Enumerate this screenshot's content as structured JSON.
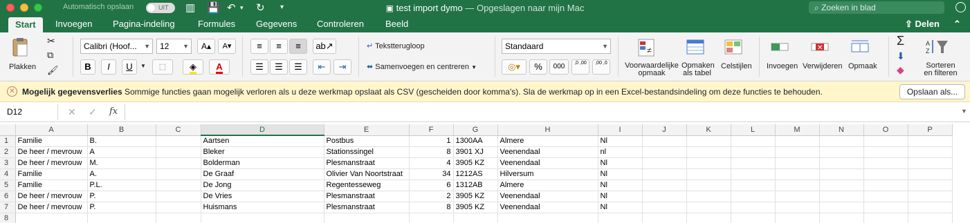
{
  "titlebar": {
    "autosave_label": "Automatisch opslaan",
    "autosave_state": "UIT",
    "doc_name": "test import dymo",
    "doc_status": "— Opgeslagen naar mijn Mac",
    "search_placeholder": "Zoeken in blad"
  },
  "tabs": [
    "Start",
    "Invoegen",
    "Pagina-indeling",
    "Formules",
    "Gegevens",
    "Controleren",
    "Beeld"
  ],
  "share_label": "Delen",
  "ribbon": {
    "paste_label": "Plakken",
    "font_name": "Calibri (Hoof...",
    "font_size": "12",
    "wrap_label": "Tekstterugloop",
    "merge_label": "Samenvoegen en centreren",
    "number_format": "Standaard",
    "conditional_label": "Voorwaardelijke opmaak",
    "format_table_label": "Opmaken als tabel",
    "cell_styles_label": "Celstijlen",
    "insert_label": "Invoegen",
    "delete_label": "Verwijderen",
    "format_label": "Opmaak",
    "sort_filter_label": "Sorteren en filteren",
    "bold": "B",
    "italic": "I",
    "underline": "U",
    "percent": "%",
    "thousands": "000",
    "inc_decimal": ",0 ,00",
    "dec_decimal": ",00 ,0"
  },
  "infobar": {
    "title": "Mogelijk gegevensverlies",
    "message": "Sommige functies gaan mogelijk verloren als u deze werkmap opslaat als CSV (gescheiden door komma's). Sla de werkmap op in een Excel-bestandsindeling om deze functies te behouden.",
    "button": "Opslaan als..."
  },
  "formula_bar": {
    "cell_ref": "D12",
    "fx": "fx",
    "formula": ""
  },
  "sheet": {
    "columns": [
      "A",
      "B",
      "C",
      "D",
      "E",
      "F",
      "G",
      "H",
      "I",
      "J",
      "K",
      "L",
      "M",
      "N",
      "O",
      "P"
    ],
    "selected_column": "D",
    "rows": [
      {
        "n": "1",
        "cells": [
          "Familie",
          "B.",
          "",
          "Aartsen",
          "Postbus",
          "1",
          "1300AA",
          "Almere",
          "Nl"
        ]
      },
      {
        "n": "2",
        "cells": [
          "De heer / mevrouw",
          "A",
          "",
          "Bleker",
          "Stationssingel",
          "8",
          "3901 XJ",
          "Veenendaal",
          "nl"
        ]
      },
      {
        "n": "3",
        "cells": [
          "De heer / mevrouw",
          "M.",
          "",
          "Bolderman",
          "Plesmanstraat",
          "4",
          "3905 KZ",
          "Veenendaal",
          "Nl"
        ]
      },
      {
        "n": "4",
        "cells": [
          "Familie",
          "A.",
          "",
          "De Graaf",
          "Olivier Van Noortstraat",
          "34",
          "1212AS",
          "Hilversum",
          "Nl"
        ]
      },
      {
        "n": "5",
        "cells": [
          "Familie",
          "P.L.",
          "",
          "De Jong",
          "Regentesseweg",
          "6",
          "1312AB",
          "Almere",
          "Nl"
        ]
      },
      {
        "n": "6",
        "cells": [
          "De heer / mevrouw",
          "P.",
          "",
          "De Vries",
          "Plesmanstraat",
          "2",
          "3905 KZ",
          "Veenendaal",
          "Nl"
        ]
      },
      {
        "n": "7",
        "cells": [
          "De heer / mevrouw",
          "P.",
          "",
          "Huismans",
          "Plesmanstraat",
          "8",
          "3905 KZ",
          "Veenendaal",
          "Nl"
        ]
      },
      {
        "n": "8",
        "cells": [
          "",
          "",
          "",
          "",
          "",
          "",
          "",
          "",
          ""
        ]
      }
    ]
  },
  "colors": {
    "accent": "#217346",
    "infobar_bg": "#fff6cc"
  }
}
